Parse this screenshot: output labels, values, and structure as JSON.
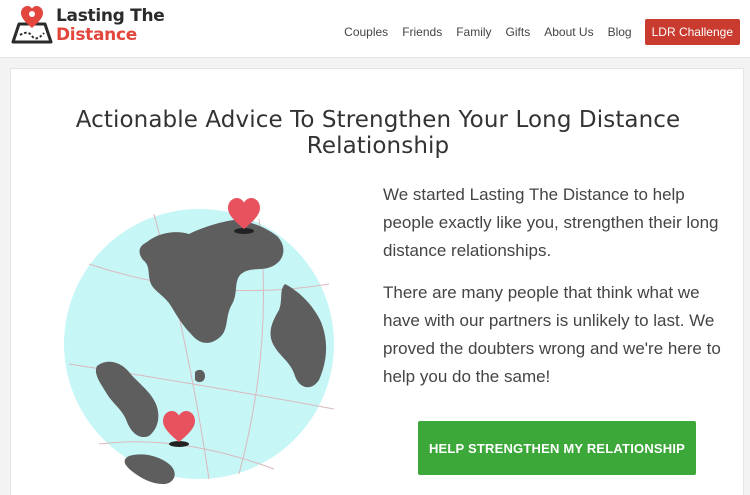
{
  "header": {
    "logo": {
      "line1": "Lasting The",
      "line2": "Distance",
      "alt": "Lasting The Distance logo"
    },
    "nav": [
      {
        "label": "Couples"
      },
      {
        "label": "Friends"
      },
      {
        "label": "Family"
      },
      {
        "label": "Gifts"
      },
      {
        "label": "About Us"
      },
      {
        "label": "Blog"
      }
    ],
    "cta_label": "LDR Challenge"
  },
  "hero": {
    "headline": "Actionable Advice To Strengthen Your Long Distance Relationship",
    "paragraphs": [
      "We started Lasting The Distance to help people exactly like you, strengthen their long distance relationships.",
      "There are many people that think what we have with our partners is unlikely to last. We proved the doubters wrong and we're here to help you do the same!"
    ],
    "button_label": "HELP STRENGTHEN MY RELATIONSHIP"
  },
  "icons": {
    "logo": "map-heart-icon",
    "globe": "globe-illustration",
    "hearts": "heart-pin-icon"
  },
  "colors": {
    "brand_red": "#e2463d",
    "cta_red": "#c83b2e",
    "button_green": "#3ca83a",
    "globe_ocean": "#c7f6f7",
    "globe_land": "#5e5e5e",
    "heart": "#e8525f"
  }
}
